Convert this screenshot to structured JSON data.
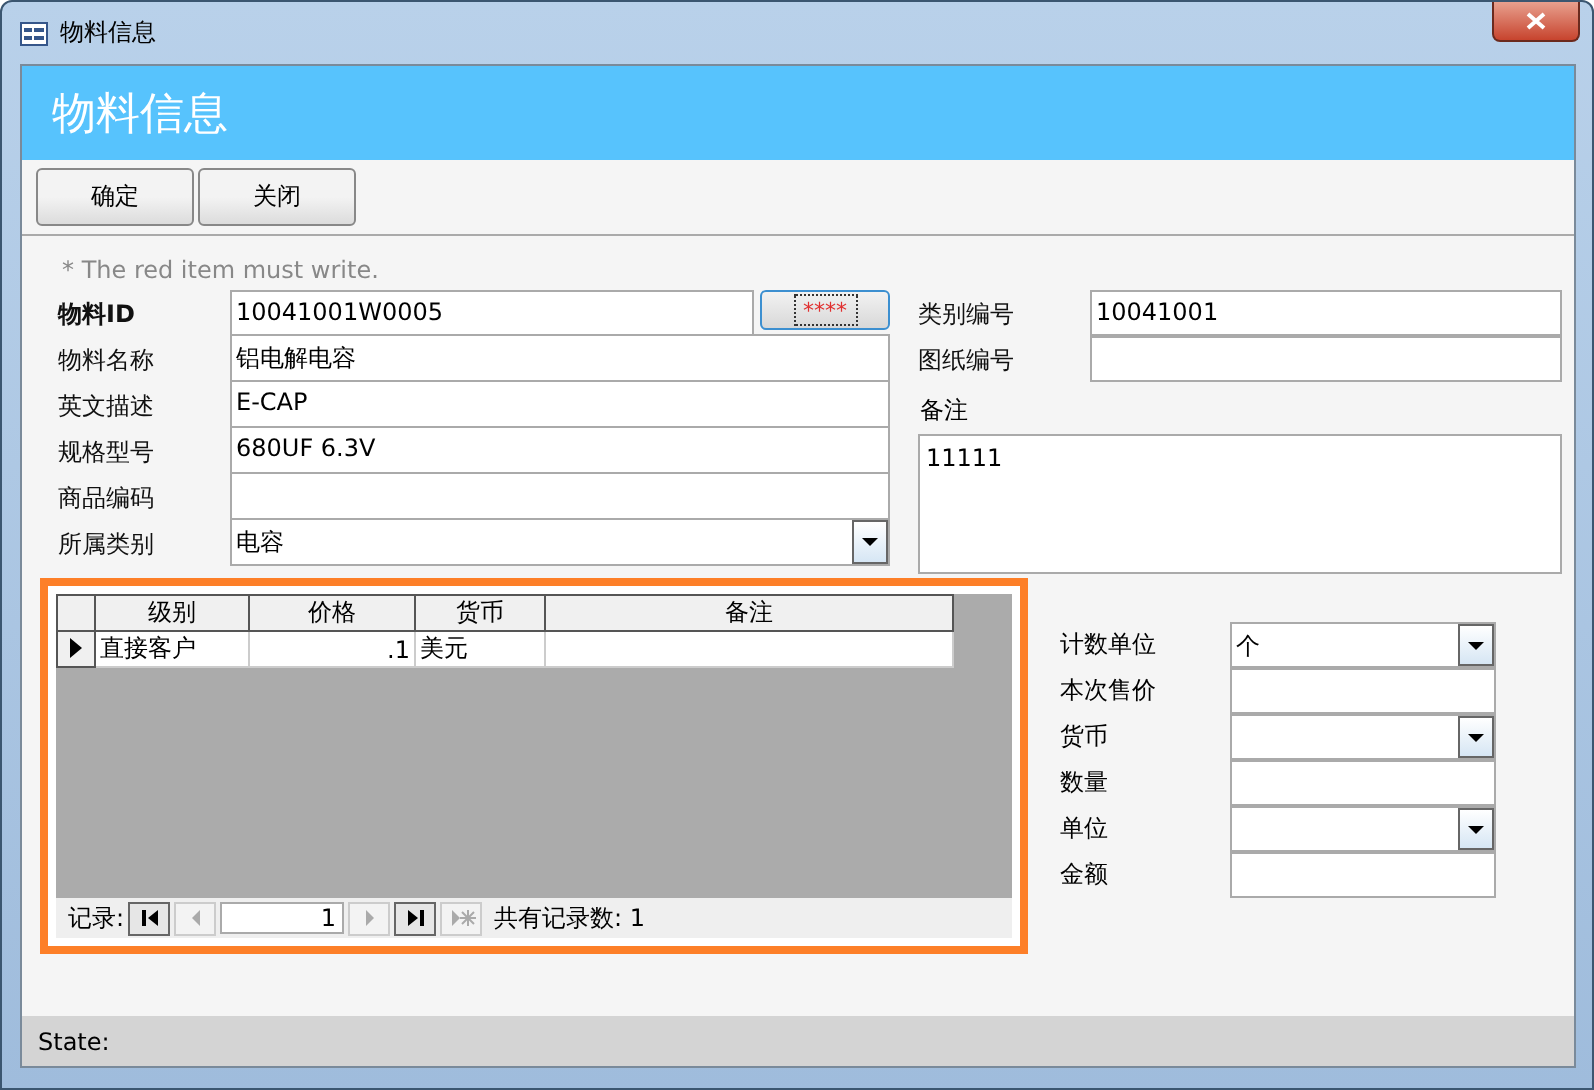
{
  "window": {
    "title": "物料信息"
  },
  "header": {
    "title": "物料信息"
  },
  "toolbar": {
    "buttons": [
      "确定",
      "关闭"
    ]
  },
  "hint": "* The red item must write.",
  "left_fields": [
    {
      "label": "物料ID",
      "value": "10041001W0005",
      "kind": "text",
      "required": true,
      "button": "****"
    },
    {
      "label": "物料名称",
      "value": "铝电解电容",
      "kind": "text",
      "required": false
    },
    {
      "label": "英文描述",
      "value": "E-CAP",
      "kind": "text",
      "required": false
    },
    {
      "label": "规格型号",
      "value": "680UF 6.3V",
      "kind": "text",
      "required": false
    },
    {
      "label": "商品编码",
      "kind": "text",
      "required": false
    },
    {
      "label": "所属类别",
      "value": "电容",
      "kind": "combo",
      "required": false
    }
  ],
  "right_fields": [
    {
      "label": "类别编号",
      "value": "10041001"
    },
    {
      "label": "图纸编号"
    }
  ],
  "notes": {
    "label": "备注",
    "value": "11111"
  },
  "subform": {
    "columns": [
      "级别",
      "价格",
      "货币",
      "备注"
    ],
    "rows": [
      {
        "selected": true,
        "cells": [
          "直接客户",
          ".1",
          "美元",
          ""
        ]
      }
    ],
    "nav": {
      "label": "记录:",
      "current": "1",
      "count": "共有记录数: 1",
      "buttons": [
        {
          "kind": "first",
          "disabled": false
        },
        {
          "kind": "prev",
          "disabled": true
        },
        {
          "kind": "next",
          "disabled": true
        },
        {
          "kind": "last",
          "disabled": false
        },
        {
          "kind": "new",
          "disabled": true
        }
      ]
    }
  },
  "side_fields": [
    {
      "label": "计数单位",
      "value": "个",
      "kind": "combo"
    },
    {
      "label": "本次售价",
      "kind": "text"
    },
    {
      "label": "货币",
      "kind": "combo"
    },
    {
      "label": "数量",
      "kind": "text"
    },
    {
      "label": "单位",
      "kind": "combo"
    },
    {
      "label": "金额",
      "kind": "text"
    }
  ],
  "status_bar": {
    "label": "State:"
  }
}
